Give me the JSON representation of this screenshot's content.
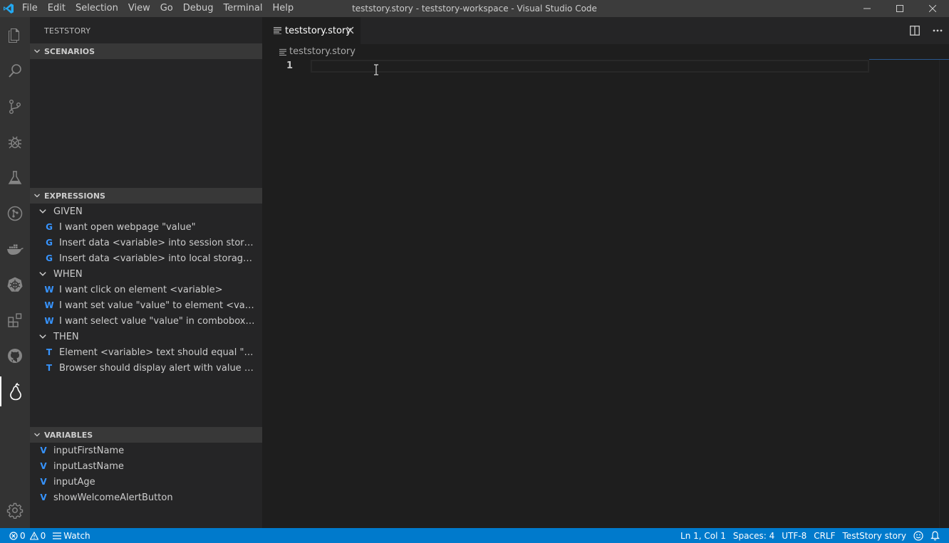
{
  "window": {
    "title": "teststory.story - teststory-workspace - Visual Studio Code",
    "menu": [
      "File",
      "Edit",
      "Selection",
      "View",
      "Go",
      "Debug",
      "Terminal",
      "Help"
    ]
  },
  "activity_bar": {
    "icons": [
      "files-icon",
      "search-icon",
      "source-control-icon",
      "debug-icon",
      "flask-icon",
      "git-graph-icon",
      "docker-icon",
      "kubernetes-icon",
      "extensions-icon",
      "github-icon",
      "pear-icon"
    ],
    "bottom_icon": "gear-icon"
  },
  "sidebar": {
    "title": "TESTSTORY",
    "scenarios": {
      "header": "SCENARIOS"
    },
    "expressions": {
      "header": "EXPRESSIONS",
      "groups": [
        {
          "label": "GIVEN",
          "items": [
            {
              "badge": "G",
              "text": "I want open webpage \"value\""
            },
            {
              "badge": "G",
              "text": "Insert data <variable> into session storage at \"value\""
            },
            {
              "badge": "G",
              "text": "Insert data <variable> into local storage at \"value\""
            }
          ]
        },
        {
          "label": "WHEN",
          "items": [
            {
              "badge": "W",
              "text": "I want click on element <variable>"
            },
            {
              "badge": "W",
              "text": "I want set value \"value\" to element <variable>"
            },
            {
              "badge": "W",
              "text": "I want select value \"value\" in combobox <variable>"
            }
          ]
        },
        {
          "label": "THEN",
          "items": [
            {
              "badge": "T",
              "text": "Element <variable> text should equal \"value\""
            },
            {
              "badge": "T",
              "text": "Browser should display alert with value \"value\""
            }
          ]
        }
      ]
    },
    "variables": {
      "header": "VARIABLES",
      "items": [
        {
          "badge": "V",
          "text": "inputFirstName"
        },
        {
          "badge": "V",
          "text": "inputLastName"
        },
        {
          "badge": "V",
          "text": "inputAge"
        },
        {
          "badge": "V",
          "text": "showWelcomeAlertButton"
        }
      ]
    }
  },
  "editor": {
    "tab_label": "teststory.story",
    "breadcrumb": "teststory.story",
    "line_number": "1"
  },
  "statusbar": {
    "errors": "0",
    "warnings": "0",
    "watch": "Watch",
    "position": "Ln 1, Col 1",
    "spaces": "Spaces: 4",
    "encoding": "UTF-8",
    "eol": "CRLF",
    "language": "TestStory story"
  },
  "colors": {
    "accent": "#007acc",
    "badge": "#3794ff",
    "sidebar_bg": "#252526",
    "editor_bg": "#1e1e1e"
  }
}
